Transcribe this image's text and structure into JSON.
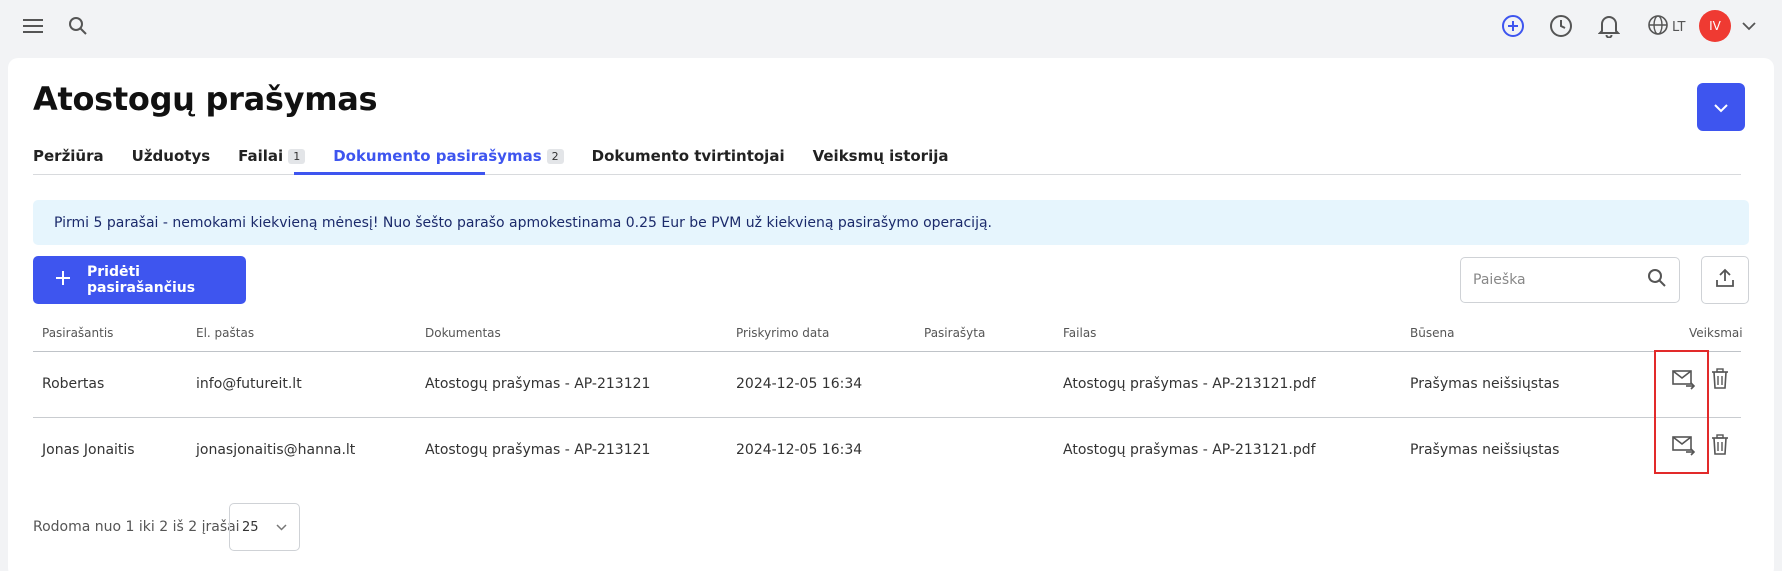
{
  "topbar": {
    "lang_label": "LT",
    "avatar_initials": "IV"
  },
  "page": {
    "title": "Atostogų prašymas"
  },
  "tabs": [
    {
      "label": "Peržiūra",
      "count": null
    },
    {
      "label": "Užduotys",
      "count": null
    },
    {
      "label": "Failai",
      "count": "1"
    },
    {
      "label": "Dokumento pasirašymas",
      "count": "2"
    },
    {
      "label": "Dokumento tvirtintojai",
      "count": null
    },
    {
      "label": "Veiksmų istorija",
      "count": null
    }
  ],
  "notice": {
    "text": "Pirmi 5 parašai - nemokami kiekvieną mėnesį! Nuo šešto parašo apmokestinama 0.25 Eur be PVM už kiekvieną pasirašymo operaciją."
  },
  "toolbar": {
    "add_label": "Pridėti pasirašančius",
    "search_placeholder": "Paieška"
  },
  "table": {
    "columns": [
      "Pasirašantis",
      "El. paštas",
      "Dokumentas",
      "Priskyrimo data",
      "Pasirašyta",
      "Failas",
      "Būsena",
      "Veiksmai"
    ],
    "rows": [
      {
        "signer": "Robertas",
        "email": "info@futureit.lt",
        "document": "Atostogų prašymas - AP-213121",
        "assigned": "2024-12-05 16:34",
        "signed": "",
        "file": "Atostogų prašymas - AP-213121.pdf",
        "status": "Prašymas neišsiųstas"
      },
      {
        "signer": "Jonas Jonaitis",
        "email": "jonasjonaitis@hanna.lt",
        "document": "Atostogų prašymas - AP-213121",
        "assigned": "2024-12-05 16:34",
        "signed": "",
        "file": "Atostogų prašymas - AP-213121.pdf",
        "status": "Prašymas neišsiųstas"
      }
    ]
  },
  "pagination": {
    "summary": "Rodoma nuo 1 iki 2 iš 2 įrašai",
    "page_size": "25"
  },
  "colors": {
    "accent": "#3e55ef",
    "avatar": "#ef3a32",
    "notice_bg": "#e6f5fd",
    "highlight": "#e22a2a"
  },
  "icons": [
    "menu-icon",
    "search-icon",
    "plus-circle-icon",
    "clock-icon",
    "bell-icon",
    "globe-icon",
    "chevron-down-icon",
    "plus-icon",
    "upload-icon",
    "send-mail-icon",
    "trash-icon"
  ]
}
